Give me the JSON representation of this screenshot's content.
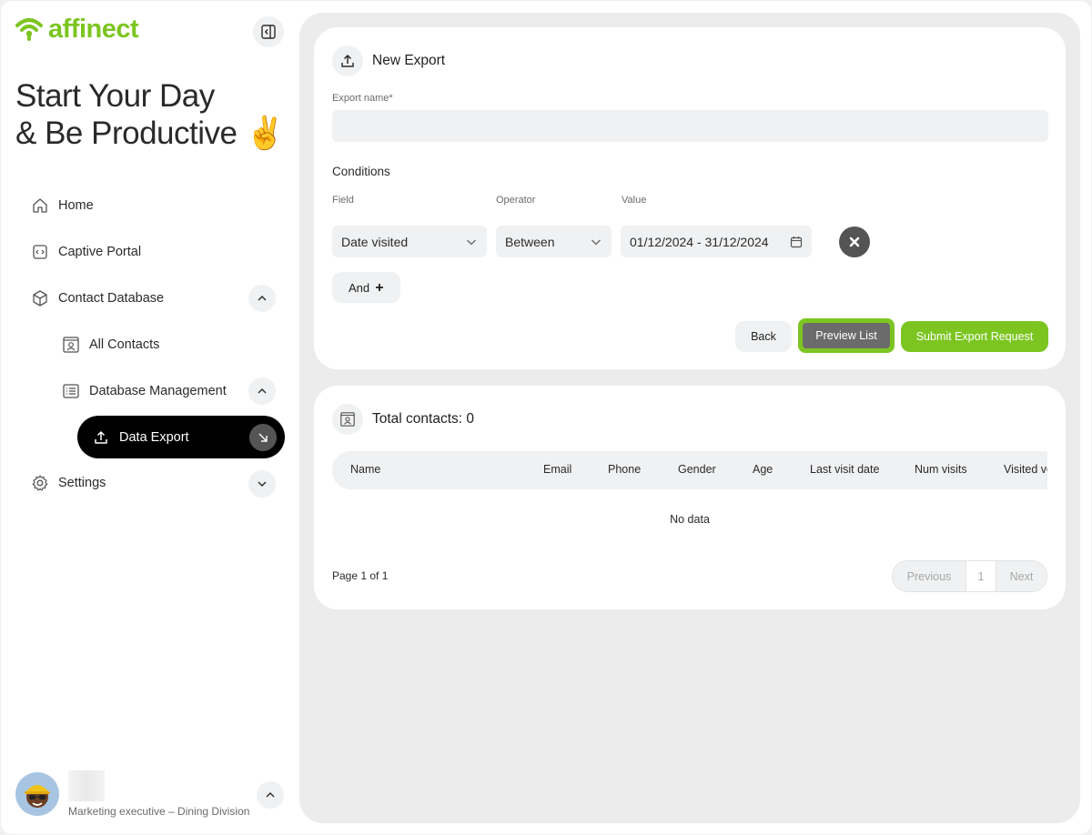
{
  "brand": {
    "name": "affinect",
    "color": "#7cc521"
  },
  "sidebar": {
    "headline_line1": "Start Your Day",
    "headline_line2": "& Be Productive ✌️",
    "items": {
      "home": "Home",
      "captive_portal": "Captive Portal",
      "contact_database": "Contact Database",
      "all_contacts": "All Contacts",
      "database_management": "Database Management",
      "data_export": "Data Export",
      "settings": "Settings"
    },
    "user": {
      "role": "Marketing executive – Dining Division"
    }
  },
  "export_form": {
    "title": "New Export",
    "name_label": "Export name*",
    "name_value": "",
    "conditions_label": "Conditions",
    "field_header": "Field",
    "operator_header": "Operator",
    "value_header": "Value",
    "field_value": "Date visited",
    "operator_value": "Between",
    "date_range": "01/12/2024 - 31/12/2024",
    "and_label": "And",
    "back_label": "Back",
    "preview_label": "Preview List",
    "submit_label": "Submit Export Request"
  },
  "results": {
    "total_label": "Total contacts: 0",
    "columns": [
      "Name",
      "Email",
      "Phone",
      "Gender",
      "Age",
      "Last visit date",
      "Num visits",
      "Visited ve"
    ],
    "empty_text": "No data",
    "page_info": "Page 1 of 1",
    "prev_label": "Previous",
    "current_page": "1",
    "next_label": "Next"
  }
}
